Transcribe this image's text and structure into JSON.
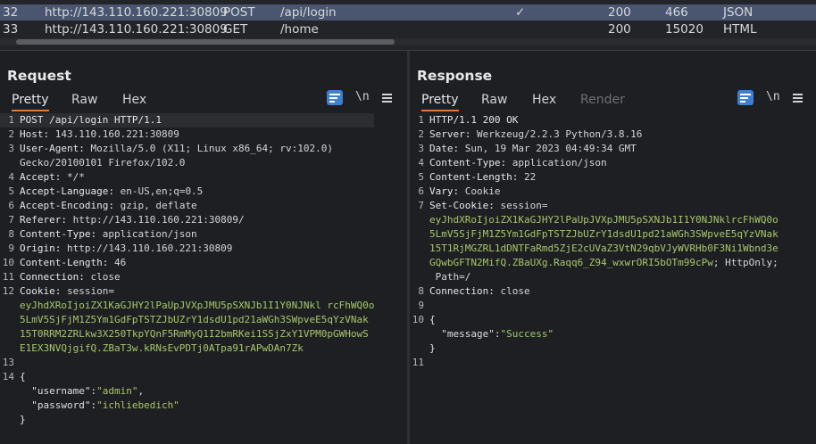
{
  "history": {
    "rows": [
      {
        "num": "32",
        "host": "http://143.110.160.221:30809",
        "method": "POST",
        "path": "/api/login",
        "flag": "✓",
        "status": "200",
        "length": "466",
        "mime": "JSON"
      },
      {
        "num": "33",
        "host": "http://143.110.160.221:30809",
        "method": "GET",
        "path": "/home",
        "flag": "",
        "status": "200",
        "length": "15020",
        "mime": "HTML"
      }
    ]
  },
  "request": {
    "title": "Request",
    "tabs": [
      "Pretty",
      "Raw",
      "Hex"
    ],
    "nl": "\\n",
    "lines": [
      {
        "n": "1",
        "k": "POST /api/login HTTP/1.1",
        "v": ""
      },
      {
        "n": "2",
        "k": "Host:",
        "v": " 143.110.160.221:30809"
      },
      {
        "n": "3",
        "k": "User-Agent:",
        "v": " Mozilla/5.0 (X11; Linux x86_64; rv:102.0)"
      },
      {
        "n": "",
        "k": "",
        "v": "Gecko/20100101 Firefox/102.0"
      },
      {
        "n": "4",
        "k": "Accept:",
        "v": " */*"
      },
      {
        "n": "5",
        "k": "Accept-Language:",
        "v": " en-US,en;q=0.5"
      },
      {
        "n": "6",
        "k": "Accept-Encoding:",
        "v": " gzip, deflate"
      },
      {
        "n": "7",
        "k": "Referer:",
        "v": " http://143.110.160.221:30809/"
      },
      {
        "n": "8",
        "k": "Content-Type:",
        "v": " application/json"
      },
      {
        "n": "9",
        "k": "Origin:",
        "v": " http://143.110.160.221:30809"
      },
      {
        "n": "10",
        "k": "Content-Length:",
        "v": " 46"
      },
      {
        "n": "11",
        "k": "Connection:",
        "v": " close"
      },
      {
        "n": "12",
        "k": "Cookie:",
        "v": " session="
      },
      {
        "n": "",
        "g": "eyJhdXRoIjoiZX1KaGJHY2lPaUpJVXpJMU5pSXNJb1I1Y0NJNkl rcFhWQ0o"
      },
      {
        "n": "",
        "g": "5LmV5SjFjM1Z5Ym1GdFpTSTZJbUZrY1dsdU1pd21aWGh3SWpveE5qYzVNak"
      },
      {
        "n": "",
        "g": "15T0RRM2ZRLkw3X250TkpYQnF5RmMyQ1I2bmRKei1SSjZxY1VPM0pGWHowS"
      },
      {
        "n": "",
        "g": "E1EX3NVQjgifQ.ZBaT3w.kRNsEvPDTj0ATpa91rAPwDAn7Zk"
      },
      {
        "n": "13",
        "k": "",
        "v": ""
      },
      {
        "n": "14",
        "k": "{",
        "v": ""
      },
      {
        "n": "",
        "jk": "  \"username\"",
        "jv": "\"admin\"",
        "end": ","
      },
      {
        "n": "",
        "jk": "  \"password\"",
        "jv": "\"ichliebedich\"",
        "end": ""
      },
      {
        "n": "",
        "k": "}",
        "v": ""
      }
    ]
  },
  "response": {
    "title": "Response",
    "tabs": [
      "Pretty",
      "Raw",
      "Hex",
      "Render"
    ],
    "nl": "\\n",
    "lines": [
      {
        "n": "1",
        "k": "HTTP/1.1 200 OK",
        "v": ""
      },
      {
        "n": "2",
        "k": "Server:",
        "v": " Werkzeug/2.2.3 Python/3.8.16"
      },
      {
        "n": "3",
        "k": "Date:",
        "v": " Sun, 19 Mar 2023 04:49:34 GMT"
      },
      {
        "n": "4",
        "k": "Content-Type:",
        "v": " application/json"
      },
      {
        "n": "5",
        "k": "Content-Length:",
        "v": " 22"
      },
      {
        "n": "6",
        "k": "Vary:",
        "v": " Cookie"
      },
      {
        "n": "7",
        "k": "Set-Cookie:",
        "v": " session="
      },
      {
        "n": "",
        "g": "eyJhdXRoIjoiZX1KaGJHY2lPaUpJVXpJMU5pSXNJb1I1Y0NJNklrcFhWQ0o"
      },
      {
        "n": "",
        "g": "5LmV5SjFjM1Z5Ym1GdFpTSTZJbUZrY1dsdU1pd21aWGh3SWpveE5qYzVNak"
      },
      {
        "n": "",
        "g": "15T1RjMGZRL1dDNTFaRmd5ZjE2cUVaZ3VtN29qbVJyWVRHb0F3Ni1Wbnd3e"
      },
      {
        "n": "",
        "g": "GQwbGFTN2MifQ.ZBaUXg.Raqq6_Z94_wxwrORI5bOTm99cPw",
        "v": "; HttpOnly;"
      },
      {
        "n": "",
        "k": "",
        "v": " Path=/"
      },
      {
        "n": "8",
        "k": "Connection:",
        "v": " close"
      },
      {
        "n": "9",
        "k": "",
        "v": ""
      },
      {
        "n": "10",
        "k": "{",
        "v": ""
      },
      {
        "n": "",
        "jk": "  \"message\"",
        "jv": "\"Success\"",
        "end": ""
      },
      {
        "n": "",
        "k": "}",
        "v": ""
      },
      {
        "n": "",
        "k": "",
        "v": ""
      },
      {
        "n": "11",
        "k": "",
        "v": ""
      }
    ]
  }
}
